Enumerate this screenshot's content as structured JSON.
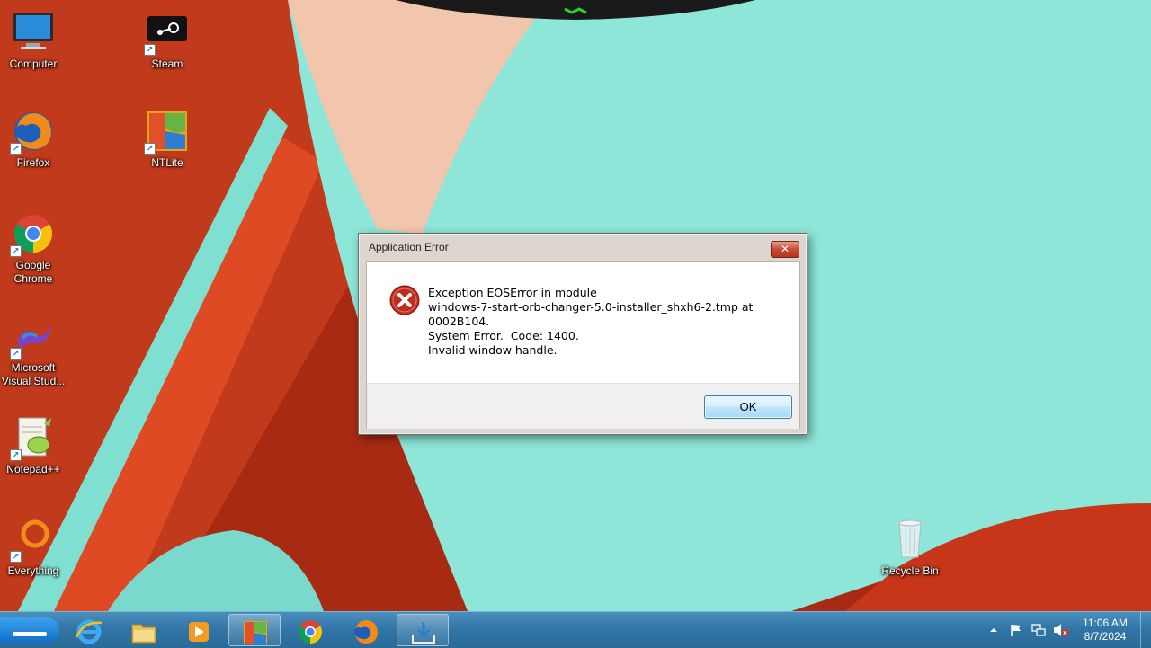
{
  "desktop": {
    "icons": [
      {
        "label": "Computer",
        "icon": "computer-icon"
      },
      {
        "label": "Steam",
        "icon": "steam-icon"
      },
      {
        "label": "Firefox",
        "icon": "firefox-icon"
      },
      {
        "label": "NTLite",
        "icon": "ntlite-icon"
      },
      {
        "label": "Google\nChrome",
        "icon": "chrome-icon"
      },
      {
        "label": "Microsoft\nVisual Stud...",
        "icon": "visual-studio-icon"
      },
      {
        "label": "Notepad++",
        "icon": "notepadpp-icon"
      },
      {
        "label": "Everything",
        "icon": "everything-icon"
      },
      {
        "label": "Recycle Bin",
        "icon": "recycle-bin-icon"
      }
    ]
  },
  "dialog": {
    "title": "Application Error",
    "message": "Exception EOSError in module\nwindows-7-start-orb-changer-5.0-installer_shxh6-2.tmp at\n0002B104.\nSystem Error.  Code: 1400.\nInvalid window handle.",
    "ok_label": "OK",
    "close_glyph": "✕"
  },
  "taskbar": {
    "pinned": [
      {
        "name": "internet-explorer",
        "icon": "ie-icon",
        "running": false
      },
      {
        "name": "file-explorer",
        "icon": "folder-icon",
        "running": false
      },
      {
        "name": "media-player",
        "icon": "media-player-icon",
        "running": false
      },
      {
        "name": "ntlite",
        "icon": "ntlite-icon",
        "running": true
      },
      {
        "name": "chrome",
        "icon": "chrome-icon",
        "running": false
      },
      {
        "name": "firefox",
        "icon": "firefox-icon",
        "running": false
      },
      {
        "name": "installer",
        "icon": "installer-icon",
        "running": true
      }
    ],
    "clock": {
      "time": "11:06 AM",
      "date": "8/7/2024"
    }
  },
  "colors": {
    "taskbar": "#3176a6",
    "wallpaper_red": "#c9381d",
    "wallpaper_teal": "#8fe3d6",
    "wallpaper_peach": "#f2c8b0",
    "error_red": "#c42b1c"
  }
}
